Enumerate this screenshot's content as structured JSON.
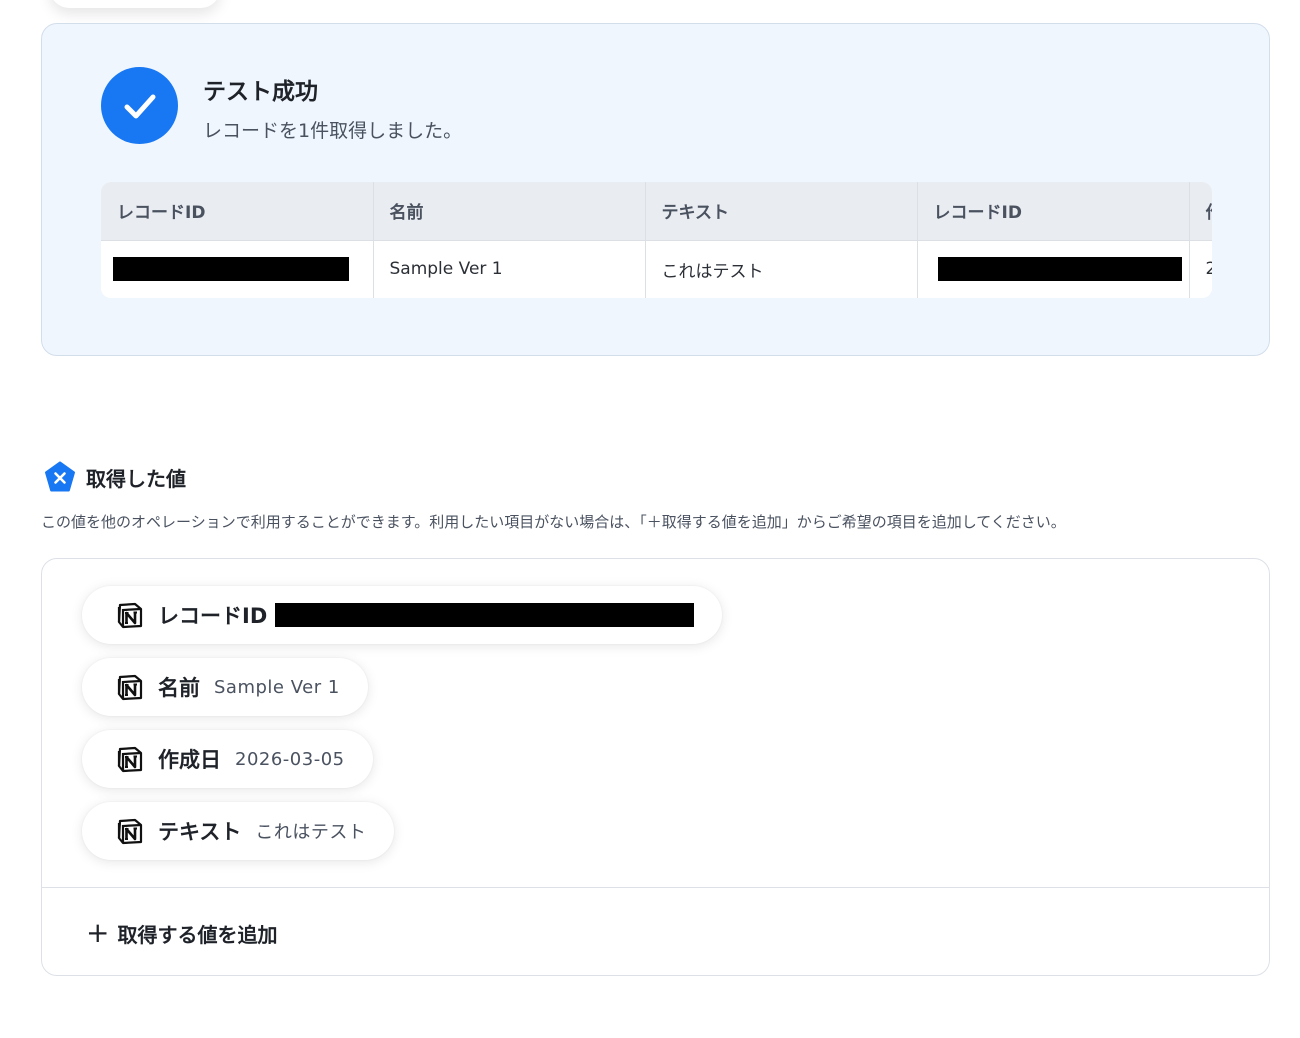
{
  "test_result": {
    "title": "テスト成功",
    "subtitle": "レコードを1件取得しました。",
    "table": {
      "headers": [
        "レコードID",
        "名前",
        "テキスト",
        "レコードID",
        "作"
      ],
      "row": [
        "",
        "Sample Ver 1",
        "これはテスト",
        "",
        "2"
      ]
    }
  },
  "acquired": {
    "title": "取得した値",
    "description": "この値を他のオペレーションで利用することができます。利用したい項目がない場合は、「＋取得する値を追加」からご希望の項目を追加してください。",
    "items": [
      {
        "label": "レコードID",
        "value": ""
      },
      {
        "label": "名前",
        "value": "Sample Ver 1"
      },
      {
        "label": "作成日",
        "value": "2026-03-05"
      },
      {
        "label": "テキスト",
        "value": "これはテスト"
      }
    ],
    "add_label": "取得する値を追加",
    "add_icon": "+"
  },
  "colors": {
    "accent": "#1877f2",
    "card_bg": "#eff6fe"
  },
  "icons": {
    "success": "check-icon",
    "section": "variable-icon",
    "item": "notion-icon"
  }
}
